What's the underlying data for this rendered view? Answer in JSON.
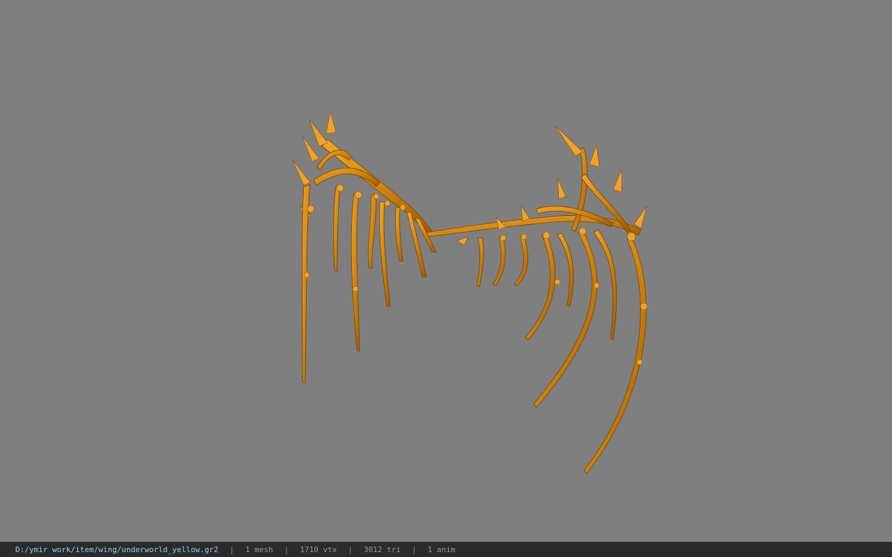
{
  "status_bar": {
    "file_path": "D:/ymir work/item/wing/underworld_yellow.gr2",
    "sep": "|",
    "mesh_count": "1 mesh",
    "vertex_count": "1710 vtx",
    "triangle_count": "3012 tri",
    "anim_count": "1 anim"
  },
  "colors": {
    "viewport_background": "#7f7f7f",
    "model_primary": "#d58a15",
    "status_path": "#8fd3f0"
  }
}
